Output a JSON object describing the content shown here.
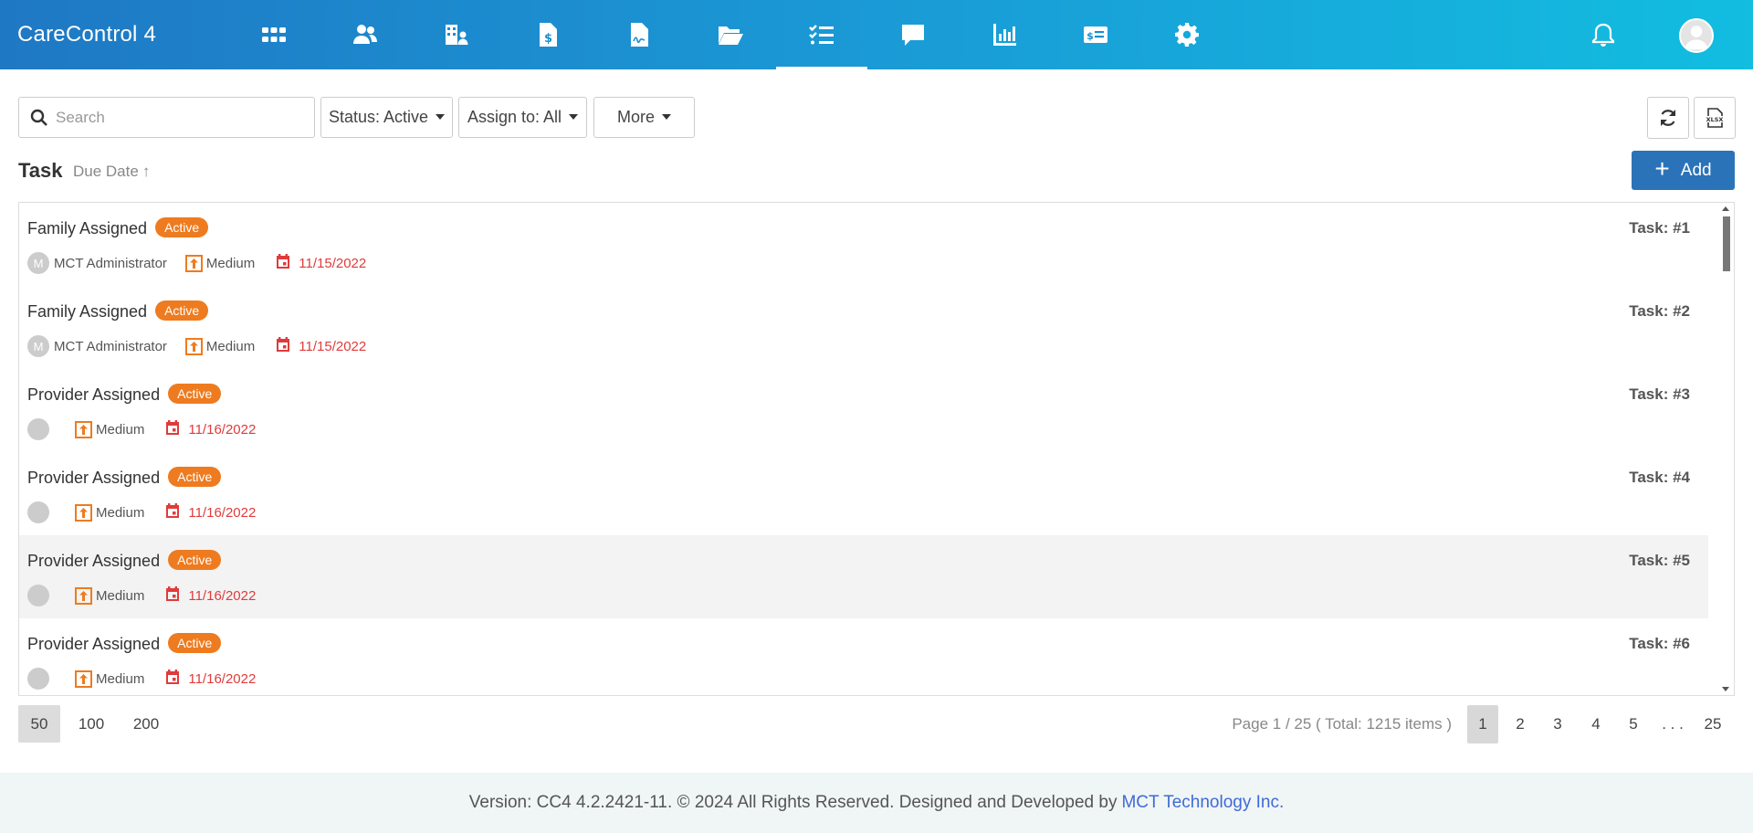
{
  "app": {
    "title": "CareControl 4"
  },
  "nav": [
    {
      "icon": "apps-grid-icon",
      "name": "nav-dashboard"
    },
    {
      "icon": "people-icon",
      "name": "nav-people"
    },
    {
      "icon": "building-icon",
      "name": "nav-facilities"
    },
    {
      "icon": "invoice-dollar-icon",
      "name": "nav-billing"
    },
    {
      "icon": "signed-document-icon",
      "name": "nav-documents"
    },
    {
      "icon": "folder-open-icon",
      "name": "nav-files"
    },
    {
      "icon": "checklist-icon",
      "name": "nav-tasks"
    },
    {
      "icon": "chat-bubble-icon",
      "name": "nav-messages"
    },
    {
      "icon": "bar-chart-icon",
      "name": "nav-reports"
    },
    {
      "icon": "id-card-icon",
      "name": "nav-cards"
    },
    {
      "icon": "gear-icon",
      "name": "nav-settings"
    }
  ],
  "filters": {
    "search_placeholder": "Search",
    "status_label": "Status: Active",
    "assign_label": "Assign to: All",
    "more_label": "More"
  },
  "header": {
    "title": "Task",
    "sort_label": "Due Date",
    "add_label": "Add"
  },
  "tasks": [
    {
      "title": "Family Assigned",
      "status": "Active",
      "number": "Task: #1",
      "assignee_initial": "M",
      "assignee": "MCT Administrator",
      "priority": "Medium",
      "due": "11/15/2022"
    },
    {
      "title": "Family Assigned",
      "status": "Active",
      "number": "Task: #2",
      "assignee_initial": "M",
      "assignee": "MCT Administrator",
      "priority": "Medium",
      "due": "11/15/2022"
    },
    {
      "title": "Provider Assigned",
      "status": "Active",
      "number": "Task: #3",
      "assignee_initial": "",
      "assignee": "",
      "priority": "Medium",
      "due": "11/16/2022"
    },
    {
      "title": "Provider Assigned",
      "status": "Active",
      "number": "Task: #4",
      "assignee_initial": "",
      "assignee": "",
      "priority": "Medium",
      "due": "11/16/2022"
    },
    {
      "title": "Provider Assigned",
      "status": "Active",
      "number": "Task: #5",
      "assignee_initial": "",
      "assignee": "",
      "priority": "Medium",
      "due": "11/16/2022"
    },
    {
      "title": "Provider Assigned",
      "status": "Active",
      "number": "Task: #6",
      "assignee_initial": "",
      "assignee": "",
      "priority": "Medium",
      "due": "11/16/2022"
    }
  ],
  "pagination": {
    "sizes": [
      "50",
      "100",
      "200"
    ],
    "info": "Page 1 / 25 ( Total: 1215 items )",
    "pages": [
      "1",
      "2",
      "3",
      "4",
      "5",
      ". . .",
      "25"
    ]
  },
  "footer": {
    "text": "Version: CC4 4.2.2421-11. © 2024 All Rights Reserved. Designed and Developed by",
    "link": "MCT Technology Inc."
  },
  "colors": {
    "accent": "#2b73b8",
    "badge": "#ee7b1f",
    "due": "#e03b3b"
  }
}
